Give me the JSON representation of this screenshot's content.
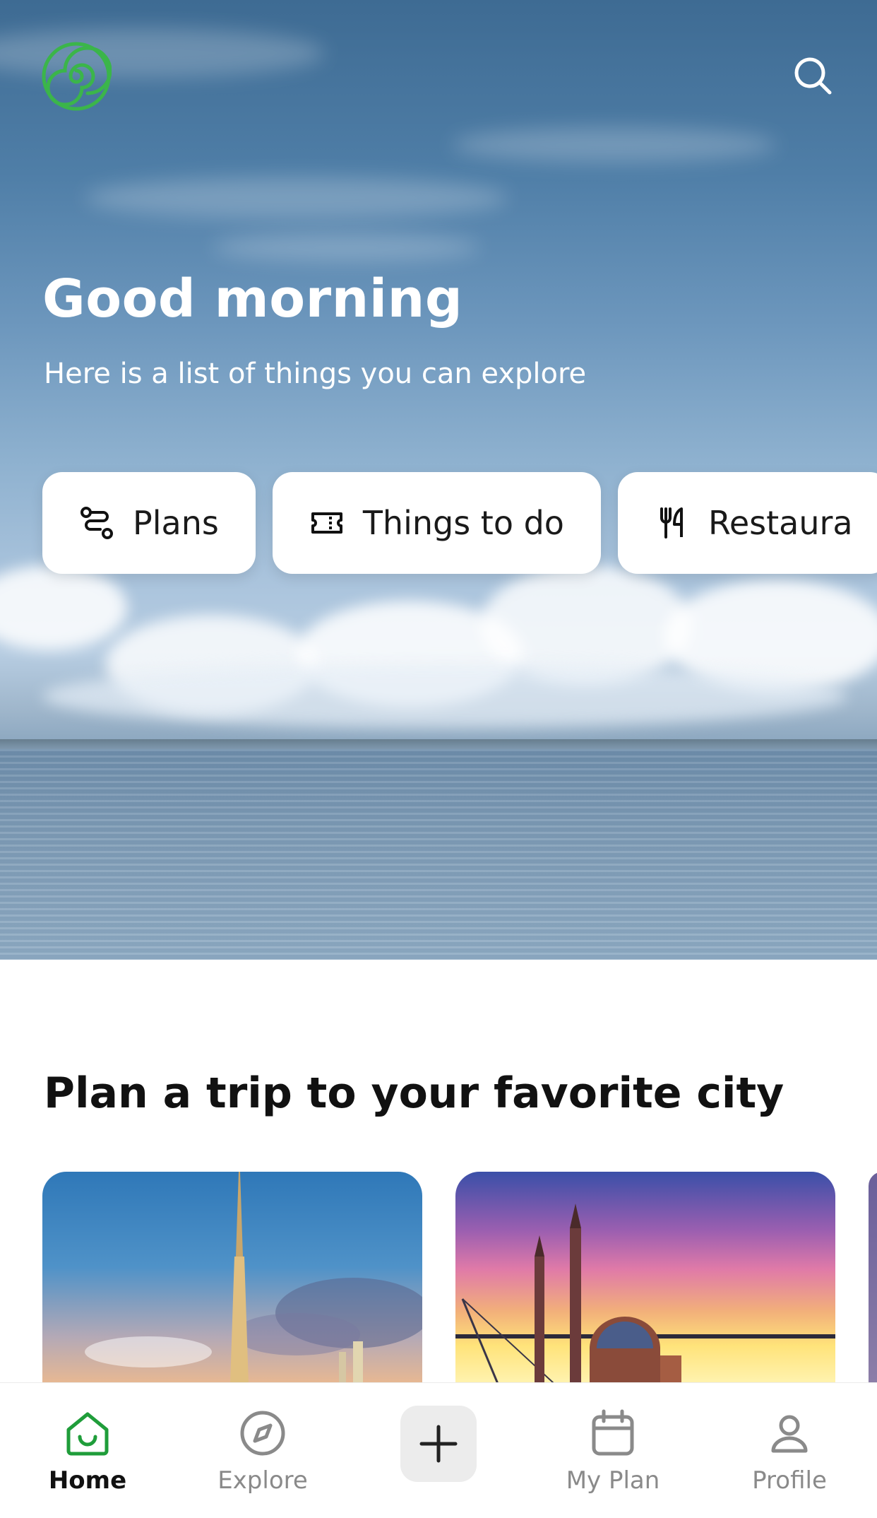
{
  "hero": {
    "greeting": "Good morning",
    "subtitle": "Here is a list of things you can explore",
    "logo_icon": "spiral-logo",
    "search_icon": "search-icon"
  },
  "categories": [
    {
      "label": "Plans",
      "icon": "route-icon"
    },
    {
      "label": "Things to do",
      "icon": "ticket-icon"
    },
    {
      "label": "Restaura",
      "icon": "fork-knife-icon"
    }
  ],
  "section": {
    "title": "Plan a trip to your favorite city"
  },
  "city_cards": [
    {
      "image": "dubai-skyline-photo"
    },
    {
      "image": "istanbul-mosque-sunset-photo"
    }
  ],
  "bottom_nav": {
    "items": [
      {
        "label": "Home",
        "icon": "home-icon",
        "active": true
      },
      {
        "label": "Explore",
        "icon": "compass-icon",
        "active": false
      },
      {
        "label": "My Plan",
        "icon": "calendar-icon",
        "active": false
      },
      {
        "label": "Profile",
        "icon": "person-icon",
        "active": false
      }
    ],
    "add_icon": "plus-icon"
  },
  "colors": {
    "brand_green": "#3bb54a",
    "active_nav": "#1f9d3a",
    "inactive_nav": "#8a8a8a"
  }
}
